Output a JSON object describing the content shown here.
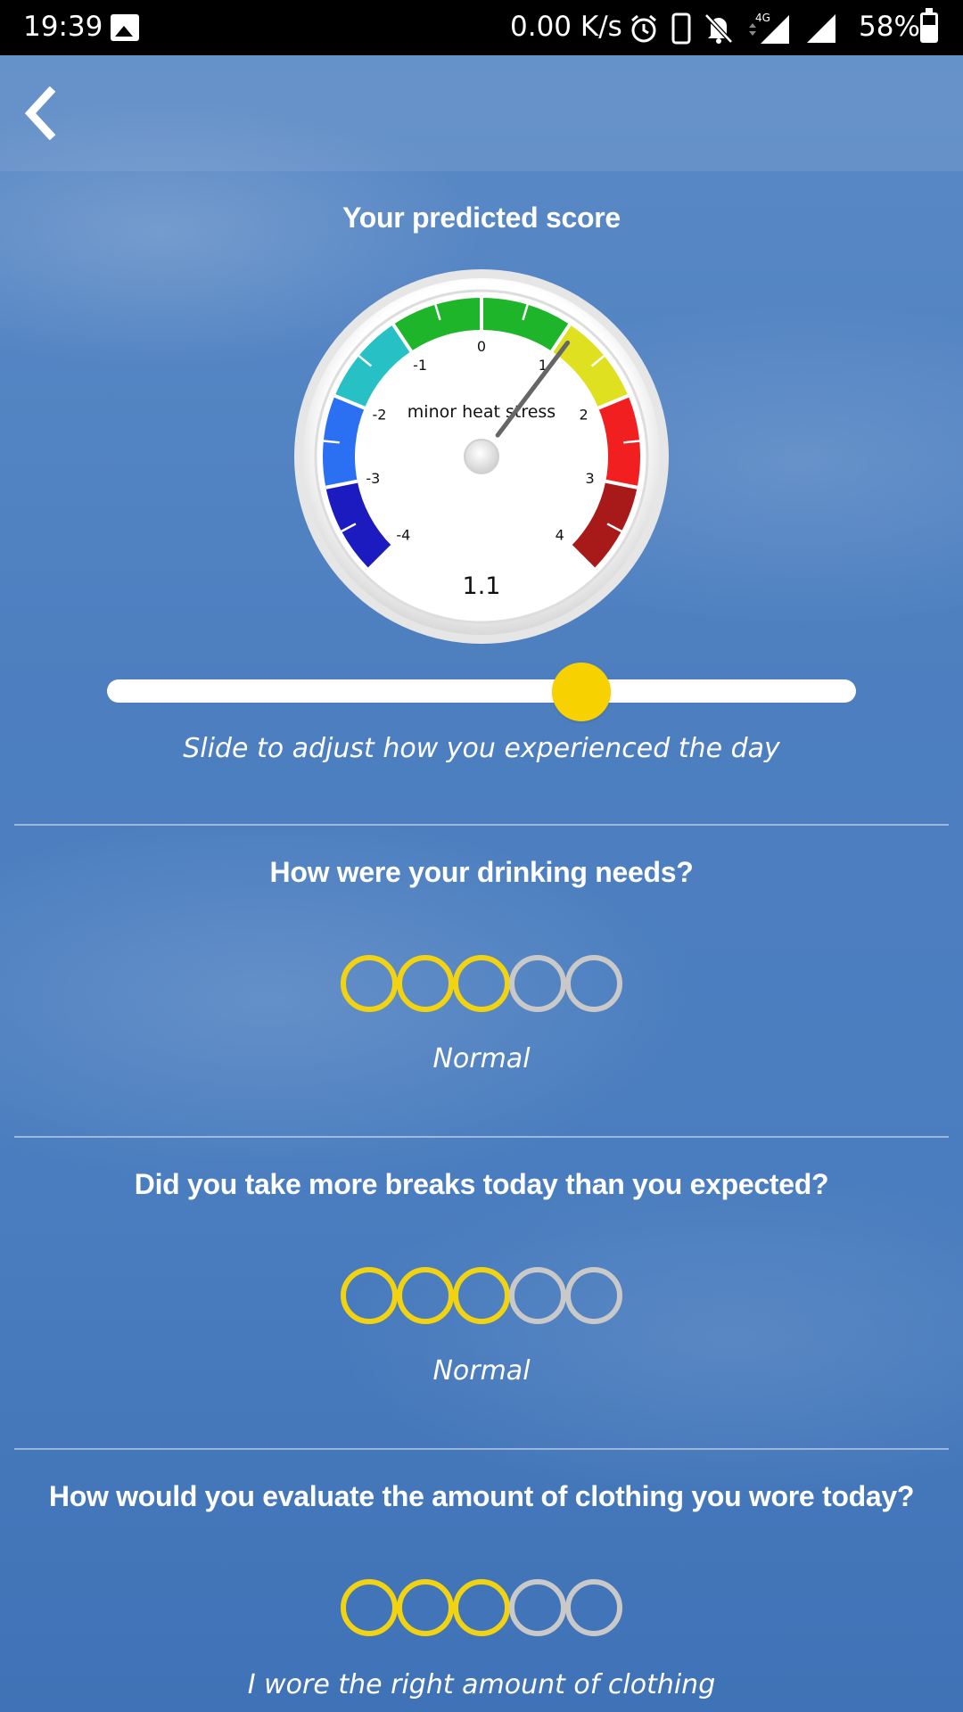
{
  "status_bar": {
    "time": "19:39",
    "network_speed": "0.00 K/s",
    "network_type": "4G",
    "battery_percent": "58%",
    "icons": [
      "image-icon",
      "alarm-icon",
      "phone-icon",
      "bell-off-icon",
      "signal-4g-icon",
      "signal-icon",
      "battery-icon"
    ]
  },
  "header": {
    "back_icon": "chevron-left-icon"
  },
  "score": {
    "title": "Your predicted score",
    "value": 1.1,
    "value_label": "1.1",
    "category": "minor heat stress",
    "scale_min": -4,
    "scale_max": 4,
    "ticks": [
      "-4",
      "-3",
      "-2",
      "-1",
      "0",
      "1",
      "2",
      "3",
      "4"
    ],
    "band_colors": [
      "#1b1bbf",
      "#2b6ff2",
      "#27c0c4",
      "#1fb52a",
      "#1fb52a",
      "#dfe020",
      "#f11f1f",
      "#a81a1a"
    ],
    "slider_value": 1.1,
    "slider_caption": "Slide to adjust how you experienced the day"
  },
  "questions": [
    {
      "question": "How were your drinking needs?",
      "rating": 3,
      "max": 5,
      "answer": "Normal"
    },
    {
      "question": "Did you take more breaks today than you expected?",
      "rating": 3,
      "max": 5,
      "answer": "Normal"
    },
    {
      "question": "How would you evaluate the amount of clothing you wore today?",
      "rating": 3,
      "max": 5,
      "answer": "I wore the right amount of clothing"
    }
  ],
  "colors": {
    "accent_yellow": "#f2d312",
    "inactive_circle": "#c9c9c9",
    "thumb": "#f7d100"
  }
}
